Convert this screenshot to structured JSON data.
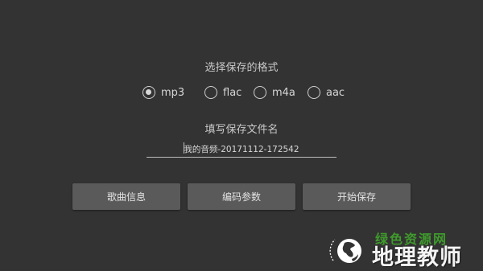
{
  "format_section": {
    "title": "选择保存的格式",
    "selected": "mp3",
    "options": [
      {
        "label": "mp3",
        "checked": true
      },
      {
        "label": "flac",
        "checked": false
      },
      {
        "label": "m4a",
        "checked": false
      },
      {
        "label": "aac",
        "checked": false
      }
    ]
  },
  "filename_section": {
    "title": "填写保存文件名",
    "value": "我的音频-20171112-172542"
  },
  "buttons": {
    "song_info": "歌曲信息",
    "encode_params": "编码参数",
    "start_save": "开始保存"
  },
  "watermark": {
    "top_text": "绿色资源网",
    "main_text": "地理教师",
    "icon": "globe-icon"
  },
  "colors": {
    "background": "#333333",
    "button": "#5a5a5a",
    "text": "#d8d8d8",
    "watermark_green": "#3f9a2c"
  }
}
